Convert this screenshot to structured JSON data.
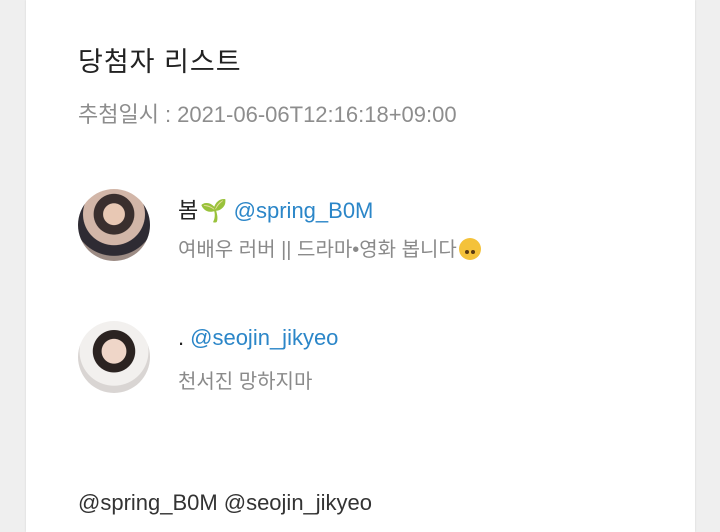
{
  "title": "당첨자 리스트",
  "draw_time": {
    "label": "추첨일시",
    "separator": ":",
    "value": "2021-06-06T12:16:18+09:00"
  },
  "winners": [
    {
      "name": "봄",
      "name_emoji": "🌱",
      "handle": "@spring_B0M",
      "bio": "여배우 러버 || 드라마•영화 봅니다",
      "bio_emoji": "upside-down-face-icon"
    },
    {
      "name": ".",
      "handle": "@seojin_jikyeo",
      "bio": "천서진 망하지마"
    }
  ],
  "mentions": [
    "@spring_B0M",
    "@seojin_jikyeo"
  ],
  "colors": {
    "handle": "#2b86c8",
    "muted": "#8a8a8a",
    "text": "#222222"
  }
}
